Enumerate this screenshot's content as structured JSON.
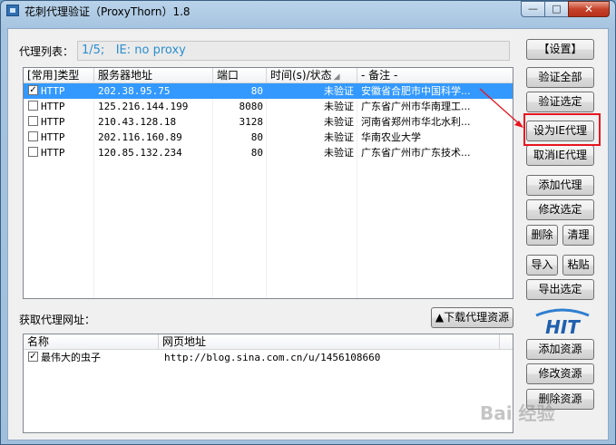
{
  "window": {
    "title": "花刺代理验证（ProxyThorn）1.8",
    "controls": {
      "minimize": "—",
      "maximize": "□",
      "close": "✕"
    }
  },
  "proxy_list": {
    "label": "代理列表：",
    "status": "1/5;   IE: no proxy",
    "columns": [
      "[常用]类型",
      "服务器地址",
      "端口",
      "时间(s)/状态",
      "- 备注 -"
    ],
    "rows": [
      {
        "checked": true,
        "type": "HTTP",
        "address": "202.38.95.75",
        "port": "80",
        "status": "未验证",
        "note": "安徽省合肥市中国科学..."
      },
      {
        "checked": false,
        "type": "HTTP",
        "address": "125.216.144.199",
        "port": "8080",
        "status": "未验证",
        "note": "广东省广州市华南理工..."
      },
      {
        "checked": false,
        "type": "HTTP",
        "address": "210.43.128.18",
        "port": "3128",
        "status": "未验证",
        "note": "河南省郑州市华北水利..."
      },
      {
        "checked": false,
        "type": "HTTP",
        "address": "202.116.160.89",
        "port": "80",
        "status": "未验证",
        "note": "华南农业大学"
      },
      {
        "checked": false,
        "type": "HTTP",
        "address": "120.85.132.234",
        "port": "80",
        "status": "未验证",
        "note": "广东省广州市广东技术..."
      }
    ]
  },
  "sources": {
    "label": "获取代理网址：",
    "download_button": "▲下载代理资源",
    "columns": [
      "名称",
      "网页地址"
    ],
    "rows": [
      {
        "checked": true,
        "name": "最伟大的虫子",
        "url": "http://blog.sina.com.cn/u/1456108660"
      }
    ]
  },
  "buttons": {
    "settings": "【设置】",
    "verify_all": "验证全部",
    "verify_selected": "验证选定",
    "set_ie_proxy": "设为IE代理",
    "cancel_ie_proxy": "取消IE代理",
    "add_proxy": "添加代理",
    "edit_selected": "修改选定",
    "delete": "删除",
    "clear": "清理",
    "import": "导入",
    "paste": "粘贴",
    "export_selected": "导出选定",
    "add_source": "添加资源",
    "edit_source": "修改资源",
    "delete_source": "删除资源"
  },
  "logo": {
    "text": "HIT"
  },
  "watermark": {
    "text": "Bai 经验"
  },
  "colors": {
    "selection": "#3399ff",
    "highlight": "#e8141e",
    "status_text": "#2a8fd0"
  }
}
